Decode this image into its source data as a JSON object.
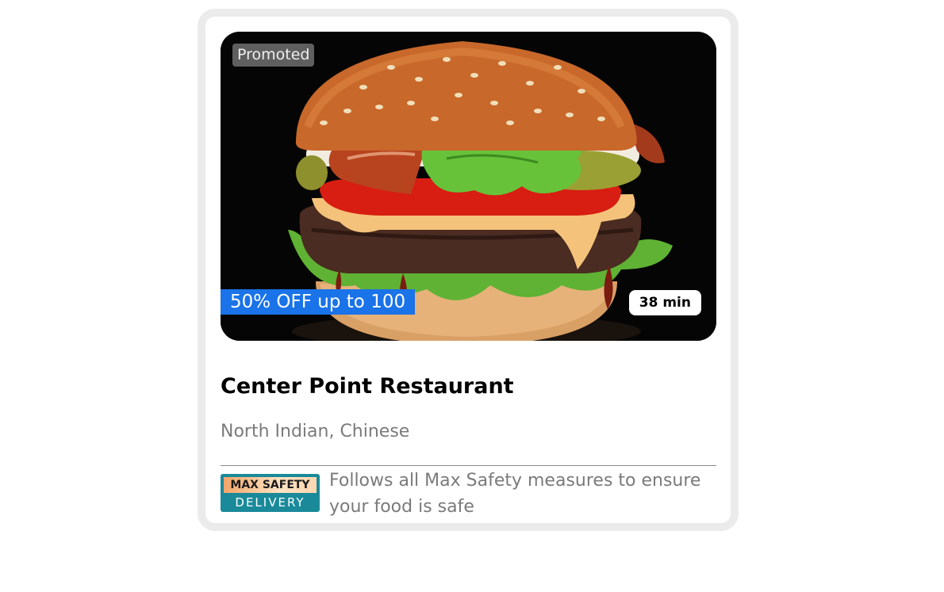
{
  "card": {
    "image": {
      "alt": "burger-image",
      "promoted_label": "Promoted",
      "offer_label": "50% OFF up to 100",
      "delivery_time": "38 min"
    },
    "restaurant_name": "Center Point Restaurant",
    "cuisines": "North Indian, Chinese",
    "safety": {
      "logo_top": "MAX SAFETY",
      "logo_bottom": "DELIVERY",
      "message": "Follows all Max Safety measures to ensure your food is safe"
    }
  },
  "colors": {
    "offer_banner": "#1a73e8",
    "card_border": "#ebebeb",
    "muted_text": "#7a7a7a",
    "safety_logo": "#1a8a9a"
  }
}
